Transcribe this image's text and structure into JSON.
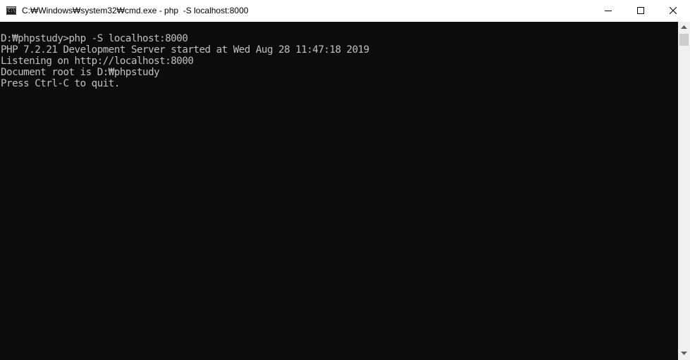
{
  "window": {
    "title": "C:₩Windows₩system32₩cmd.exe - php  -S localhost:8000",
    "icon": "cmd-icon",
    "icon_text": "C:\\",
    "controls": {
      "minimize": "minimize-icon",
      "maximize": "maximize-icon",
      "close": "close-icon"
    }
  },
  "console": {
    "lines": [
      "D:₩phpstudy>php -S localhost:8000",
      "PHP 7.2.21 Development Server started at Wed Aug 28 11:47:18 2019",
      "Listening on http://localhost:8000",
      "Document root is D:₩phpstudy",
      "Press Ctrl-C to quit."
    ],
    "text_color": "#c0c0c0",
    "background_color": "#0c0c0c"
  },
  "scrollbar": {
    "position": 0
  }
}
